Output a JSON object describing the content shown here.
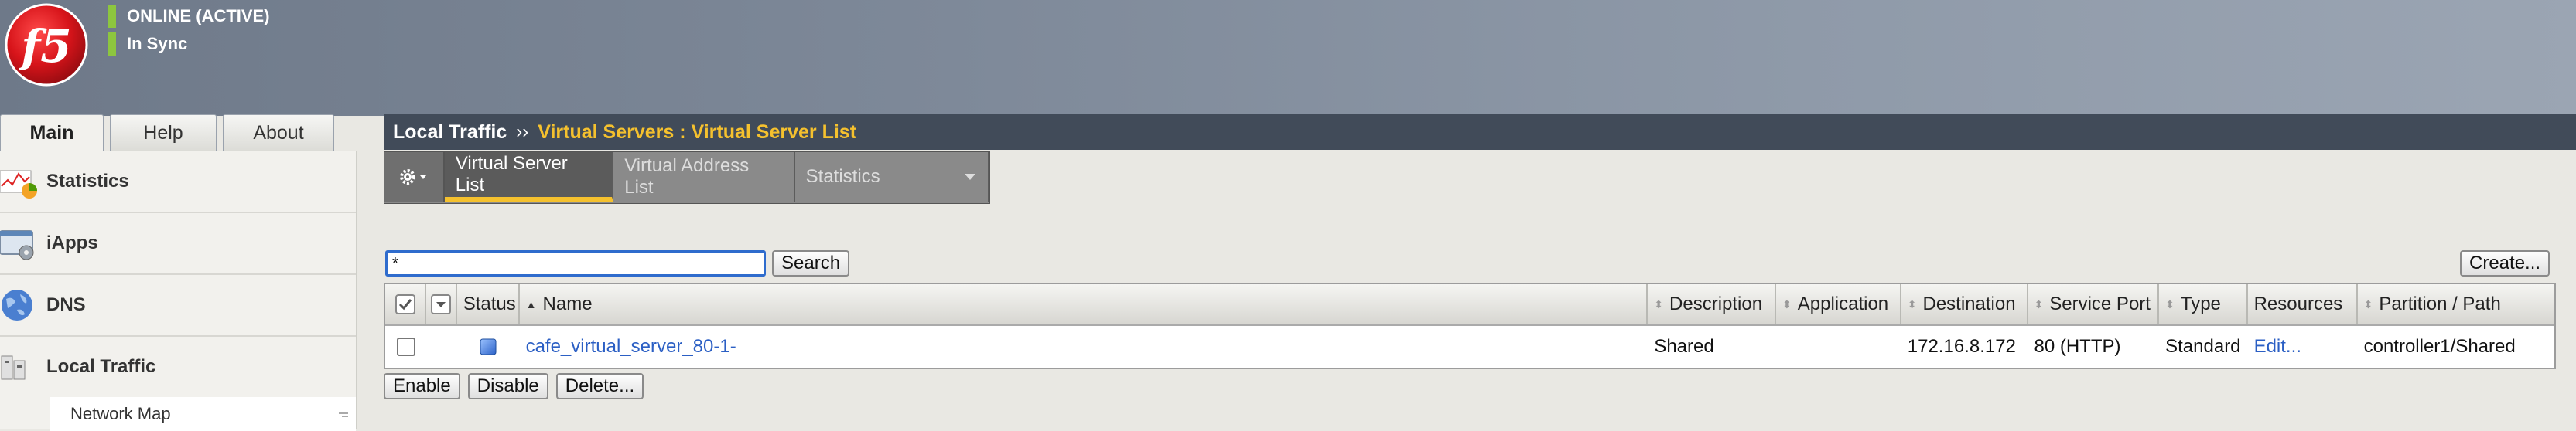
{
  "header": {
    "status": [
      "ONLINE (ACTIVE)",
      "In Sync"
    ],
    "logo_text": "f5"
  },
  "tabs": [
    "Main",
    "Help",
    "About"
  ],
  "sidebar": {
    "items": [
      {
        "label": "Statistics",
        "icon": "statistics-icon"
      },
      {
        "label": "iApps",
        "icon": "iapps-icon"
      },
      {
        "label": "DNS",
        "icon": "dns-globe-icon"
      },
      {
        "label": "Local Traffic",
        "icon": "local-traffic-icon"
      }
    ],
    "sub_items": [
      "Network Map"
    ]
  },
  "breadcrumb": {
    "home": "Local Traffic",
    "separator": "››",
    "path": "Virtual Servers : Virtual Server List"
  },
  "subnav": {
    "tabs": [
      "Virtual Server List",
      "Virtual Address List",
      "Statistics"
    ],
    "active": "Virtual Server List"
  },
  "search": {
    "value": "*",
    "button": "Search"
  },
  "create_button": "Create...",
  "table": {
    "columns": [
      "Status",
      "Name",
      "Description",
      "Application",
      "Destination",
      "Service Port",
      "Type",
      "Resources",
      "Partition / Path"
    ],
    "rows": [
      {
        "name": "cafe_virtual_server_80-1-",
        "description": "Shared",
        "application": "",
        "destination": "172.16.8.172",
        "service_port": "80 (HTTP)",
        "type": "Standard",
        "resources": "Edit...",
        "partition": "controller1/Shared"
      }
    ]
  },
  "actions": [
    "Enable",
    "Disable",
    "Delete..."
  ],
  "colors": {
    "accent": "#f5c12e",
    "status_green": "#8dc63f",
    "titlebar": "#414b59",
    "link": "#2b5fc4"
  }
}
